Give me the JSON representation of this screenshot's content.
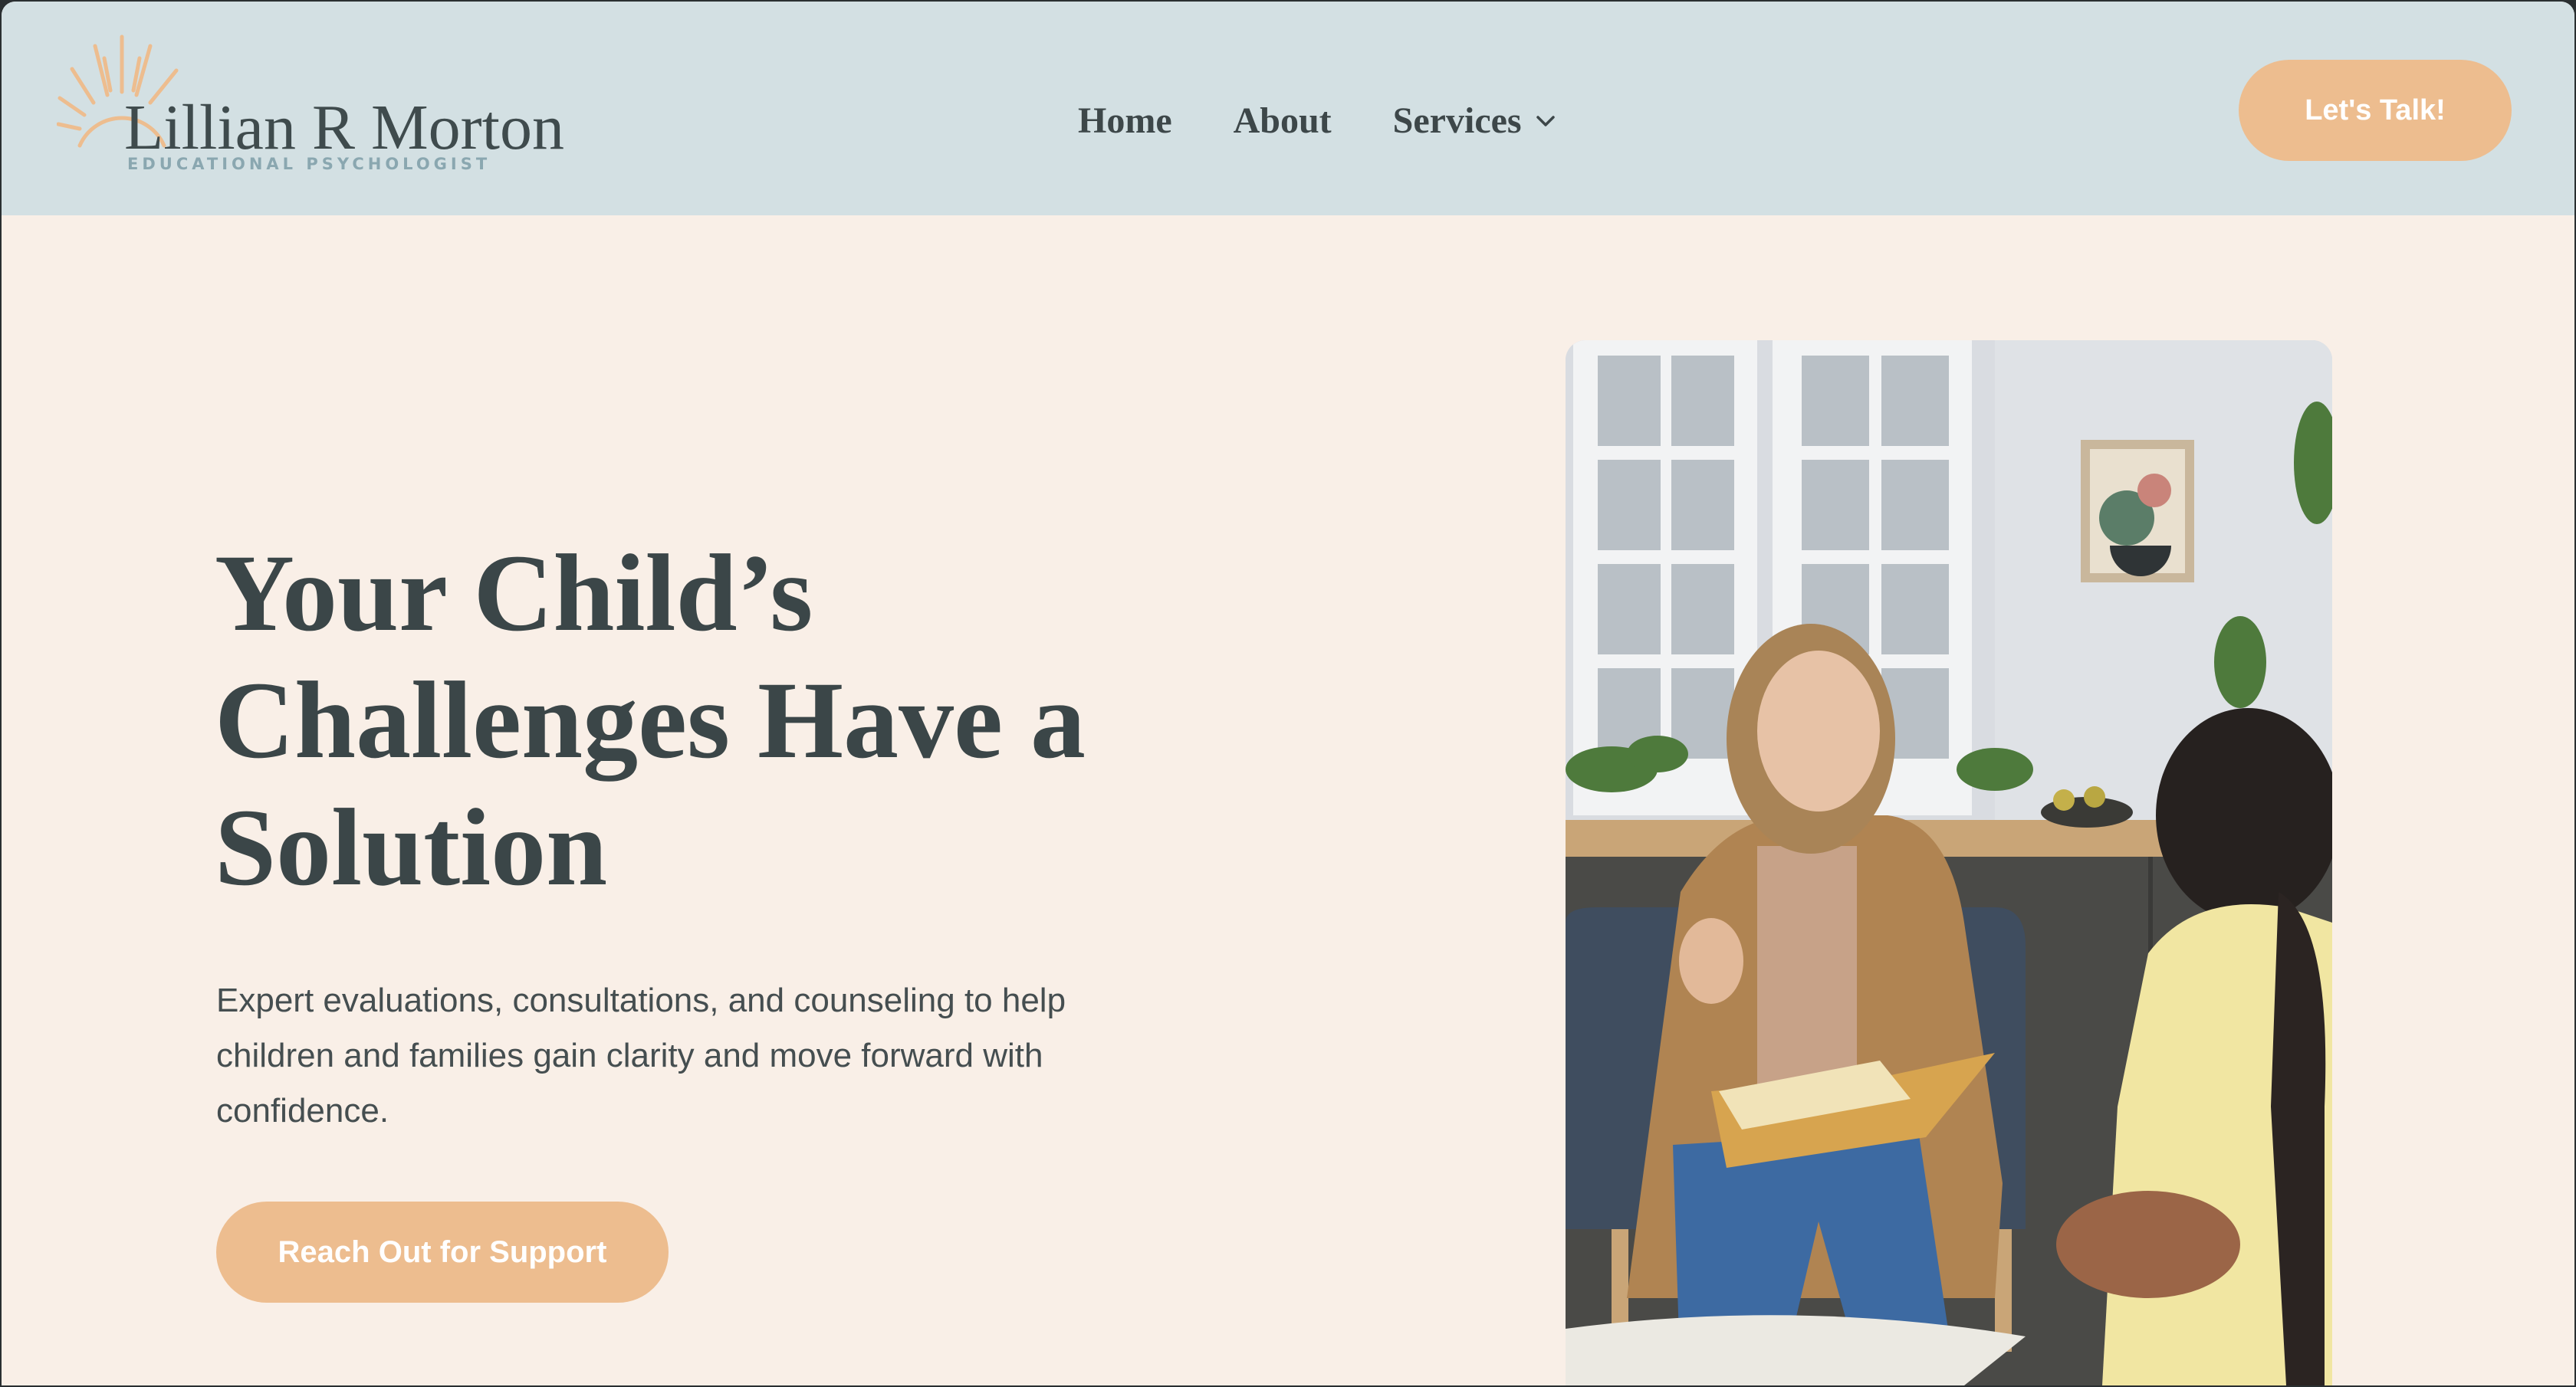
{
  "brand": {
    "name": "Lillian R Morton",
    "tagline": "EDUCATIONAL PSYCHOLOGIST",
    "sun_icon": "sun-icon",
    "accent": "#edbd8f",
    "header_bg": "#d3e0e3",
    "page_bg": "#f9efe7"
  },
  "nav": {
    "items": [
      {
        "label": "Home"
      },
      {
        "label": "About"
      },
      {
        "label": "Services",
        "icon": "chevron-down-icon"
      }
    ],
    "cta_label": "Let's Talk!"
  },
  "hero": {
    "title": "Your Child’s Challenges Have a Solution",
    "description": "Expert evaluations, consultations, and counseling to help children and families gain clarity and move forward with confidence.",
    "cta_label": "Reach Out for Support"
  }
}
